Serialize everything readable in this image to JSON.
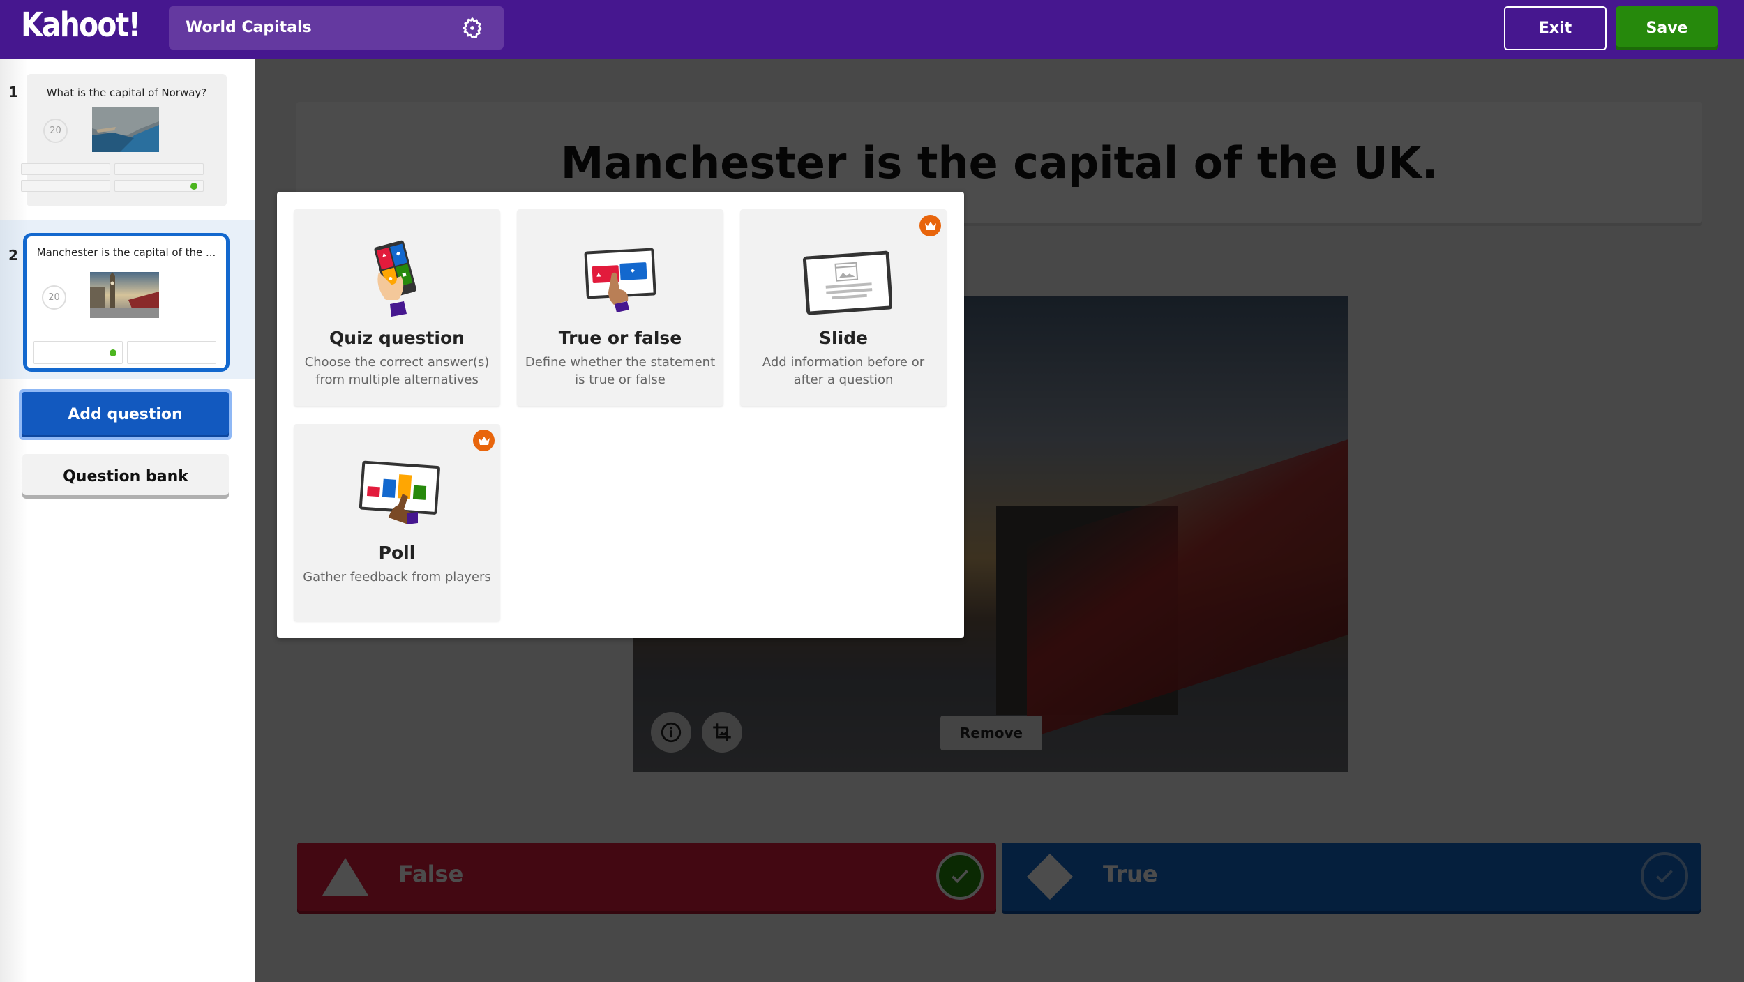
{
  "header": {
    "logo": "Kahoot!",
    "kahoot_title": "World Capitals",
    "settings_icon": "gear-icon",
    "exit_label": "Exit",
    "save_label": "Save"
  },
  "sidebar": {
    "questions": [
      {
        "number": "1",
        "text": "What is the capital of Norway?",
        "time_limit": "20",
        "thumbnail": "fjord-image",
        "answer_count": 4,
        "correct_index": 3,
        "selected": false
      },
      {
        "number": "2",
        "text": "Manchester is the capital of the ...",
        "time_limit": "20",
        "thumbnail": "london-image",
        "answer_count": 2,
        "correct_index": 0,
        "selected": true
      }
    ],
    "add_question_label": "Add question",
    "question_bank_label": "Question bank"
  },
  "editor": {
    "question_title": "Manchester is the capital of the UK.",
    "image_info_icon": "info-icon",
    "image_crop_icon": "crop-icon",
    "remove_label": "Remove",
    "answers": [
      {
        "label": "False",
        "shape": "triangle",
        "color": "#e21b3c",
        "correct": true
      },
      {
        "label": "True",
        "shape": "diamond",
        "color": "#1368ce",
        "correct": false
      }
    ]
  },
  "modal": {
    "question_types": [
      {
        "name": "Quiz question",
        "description": "Choose the correct answer(s) from multiple alternatives",
        "premium": false,
        "icon": "quiz-phone-illustration"
      },
      {
        "name": "True or false",
        "description": "Define whether the statement is true or false",
        "premium": false,
        "icon": "true-false-tablet-illustration"
      },
      {
        "name": "Slide",
        "description": "Add information before or after a question",
        "premium": true,
        "icon": "slide-tablet-illustration"
      },
      {
        "name": "Poll",
        "description": "Gather feedback from players",
        "premium": true,
        "icon": "poll-chart-illustration"
      }
    ],
    "premium_badge_icon": "crown-icon"
  },
  "colors": {
    "header_bg": "#46178f",
    "title_box_bg": "#6439a0",
    "save_green": "#26890c",
    "add_question_blue": "#1259bf",
    "selected_border": "#1368ce",
    "answer_red": "#e21b3c",
    "answer_blue": "#1368ce",
    "premium_orange": "#e8650c",
    "correct_dot": "#4cb51f"
  }
}
